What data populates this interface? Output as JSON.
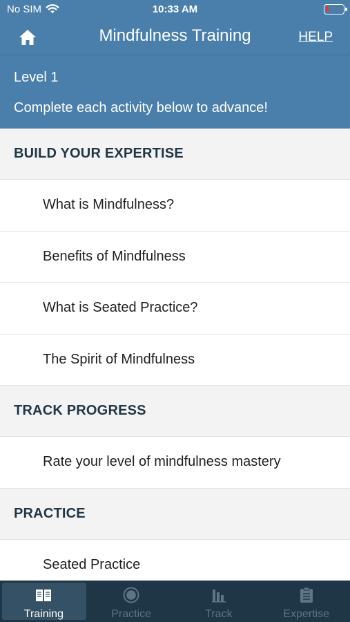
{
  "status_bar": {
    "carrier": "No SIM",
    "time": "10:33 AM"
  },
  "nav": {
    "title": "Mindfulness Training",
    "help_label": "HELP"
  },
  "level": {
    "title": "Level 1",
    "subtitle": "Complete each activity below to advance!"
  },
  "sections": [
    {
      "header": "BUILD YOUR EXPERTISE",
      "items": [
        "What is Mindfulness?",
        "Benefits of Mindfulness",
        "What is Seated Practice?",
        "The Spirit of Mindfulness"
      ]
    },
    {
      "header": "TRACK PROGRESS",
      "items": [
        "Rate your level of mindfulness mastery"
      ]
    },
    {
      "header": "PRACTICE",
      "items": [
        "Seated Practice"
      ]
    }
  ],
  "tabs": [
    {
      "label": "Training",
      "icon": "book-icon",
      "active": true
    },
    {
      "label": "Practice",
      "icon": "target-icon",
      "active": false
    },
    {
      "label": "Track",
      "icon": "bar-chart-icon",
      "active": false
    },
    {
      "label": "Expertise",
      "icon": "clipboard-icon",
      "active": false
    }
  ],
  "colors": {
    "header_blue": "#4a7fab",
    "tab_bar": "#1f3646",
    "section_bg": "#f3f3f3",
    "battery_low": "#e53935"
  }
}
